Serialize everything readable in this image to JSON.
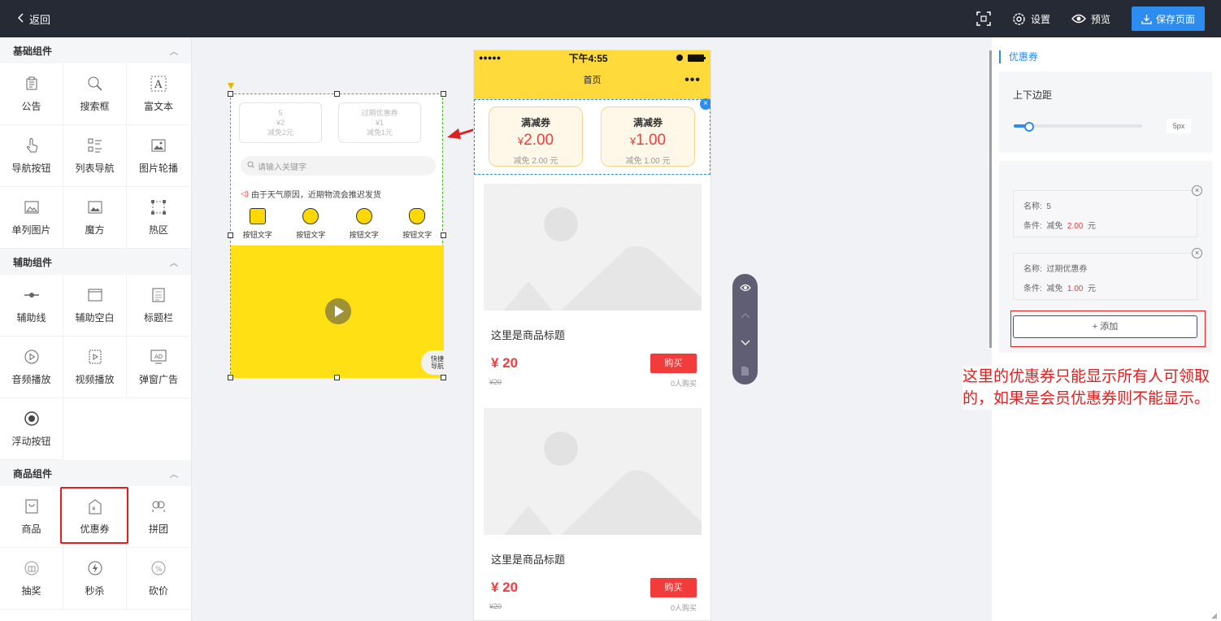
{
  "topbar": {
    "back_label": "返回",
    "settings_label": "设置",
    "preview_label": "预览",
    "save_label": "保存页面"
  },
  "left_panel": {
    "groups": [
      {
        "title": "基础组件",
        "items": [
          {
            "label": "公告",
            "icon": "notice-icon"
          },
          {
            "label": "搜索框",
            "icon": "search-icon"
          },
          {
            "label": "富文本",
            "icon": "richtext-icon"
          },
          {
            "label": "导航按钮",
            "icon": "hand-icon"
          },
          {
            "label": "列表导航",
            "icon": "list-icon"
          },
          {
            "label": "图片轮播",
            "icon": "image-icon"
          },
          {
            "label": "单列图片",
            "icon": "image-icon"
          },
          {
            "label": "魔方",
            "icon": "image-icon"
          },
          {
            "label": "热区",
            "icon": "hotzone-icon"
          }
        ]
      },
      {
        "title": "辅助组件",
        "items": [
          {
            "label": "辅助线",
            "icon": "line-icon"
          },
          {
            "label": "辅助空白",
            "icon": "blank-icon"
          },
          {
            "label": "标题栏",
            "icon": "title-icon"
          },
          {
            "label": "音频播放",
            "icon": "audio-icon"
          },
          {
            "label": "视频播放",
            "icon": "video-icon"
          },
          {
            "label": "弹窗广告",
            "icon": "ad-icon"
          },
          {
            "label": "浮动按钮",
            "icon": "float-icon"
          }
        ]
      },
      {
        "title": "商品组件",
        "items": [
          {
            "label": "商品",
            "icon": "goods-icon"
          },
          {
            "label": "优惠券",
            "icon": "coupon-icon"
          },
          {
            "label": "拼团",
            "icon": "group-icon"
          },
          {
            "label": "抽奖",
            "icon": "lottery-icon"
          },
          {
            "label": "秒杀",
            "icon": "flash-icon"
          },
          {
            "label": "砍价",
            "icon": "bargain-icon"
          }
        ]
      }
    ]
  },
  "template_preview": {
    "coupons": [
      {
        "name": "5",
        "price": "¥2",
        "cond": "减免2元"
      },
      {
        "name": "过期优惠券",
        "price": "¥1",
        "cond": "减免1元"
      }
    ],
    "search_placeholder": "请输入关键字",
    "notice": "由于天气原因，近期物流会推迟发货",
    "nav_label": "按钮文字",
    "quick_nav": "快捷导航"
  },
  "phone": {
    "signal": "●●●●●",
    "time": "下午4:55",
    "page_title": "首页",
    "more": "•••",
    "coupons": [
      {
        "title": "满减券",
        "currency": "¥",
        "amount": "2.00",
        "cond": "减免 2.00 元"
      },
      {
        "title": "满减券",
        "currency": "¥",
        "amount": "1.00",
        "cond": "减免 1.00 元"
      }
    ],
    "goods": [
      {
        "title": "这里是商品标题",
        "price": "¥ 20",
        "buy": "购买",
        "orig": "¥20",
        "sold": "0人购买"
      },
      {
        "title": "这里是商品标题",
        "price": "¥ 20",
        "buy": "购买",
        "orig": "¥20",
        "sold": "0人购买"
      }
    ]
  },
  "right_panel": {
    "title": "优惠券",
    "margin_label": "上下边距",
    "margin_value": "5px",
    "margin_fraction": 0.12,
    "name_label": "名称:",
    "cond_label": "条件:",
    "cond_prefix": "减免",
    "cond_suffix": "元",
    "coupons": [
      {
        "name": "5",
        "amount": "2.00"
      },
      {
        "name": "过期优惠券",
        "amount": "1.00"
      }
    ],
    "add_label": "+ 添加"
  },
  "annotation": "这里的优惠券只能显示所有人可领取的，如果是会员优惠券则不能显示。",
  "colors": {
    "topbar": "#262a35",
    "accent": "#2d8cf0",
    "price_red": "#f23b3b",
    "phone_header": "#ffda3a",
    "annotation_red": "#e02020"
  }
}
